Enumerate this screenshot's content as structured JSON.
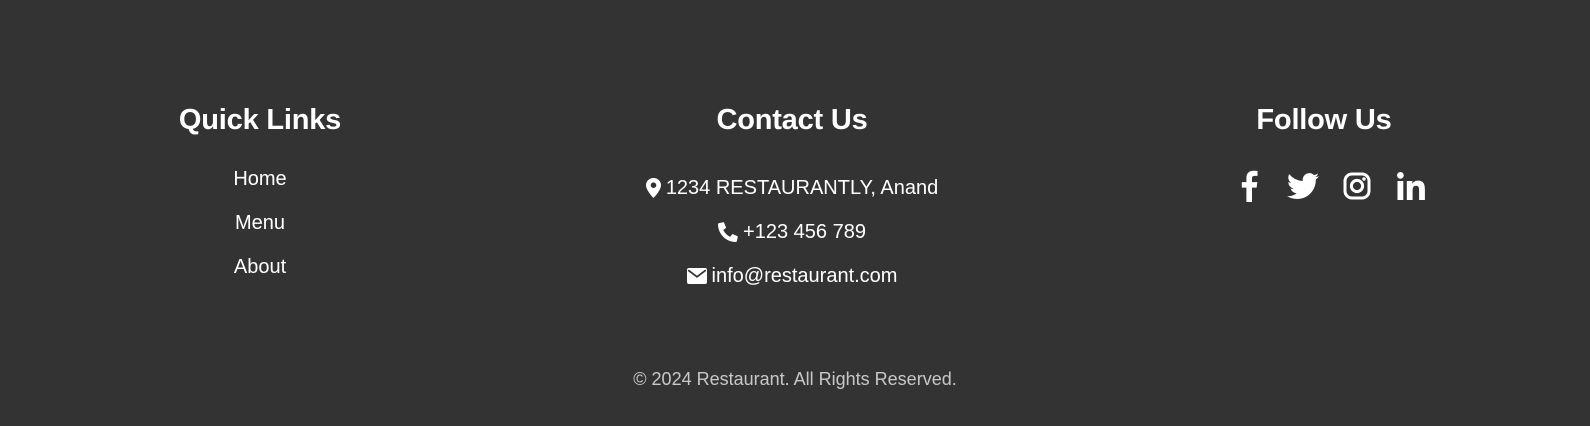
{
  "footer": {
    "quick_links": {
      "title": "Quick Links",
      "items": [
        {
          "label": "Home"
        },
        {
          "label": "Menu"
        },
        {
          "label": "About"
        }
      ]
    },
    "contact": {
      "title": "Contact Us",
      "address": {
        "icon": "map-marker-icon",
        "text": "1234 RESTAURANTLY, Anand"
      },
      "phone": {
        "icon": "phone-icon",
        "text": "+123 456 789"
      },
      "email": {
        "icon": "envelope-icon",
        "text": "info@restaurant.com"
      }
    },
    "follow": {
      "title": "Follow Us",
      "icons": [
        "facebook-icon",
        "twitter-icon",
        "instagram-icon",
        "linkedin-icon"
      ]
    },
    "copyright": "© 2024 Restaurant. All Rights Reserved.",
    "colors": {
      "background": "#333333",
      "text": "#ffffff",
      "muted": "#c8c8c8"
    }
  }
}
